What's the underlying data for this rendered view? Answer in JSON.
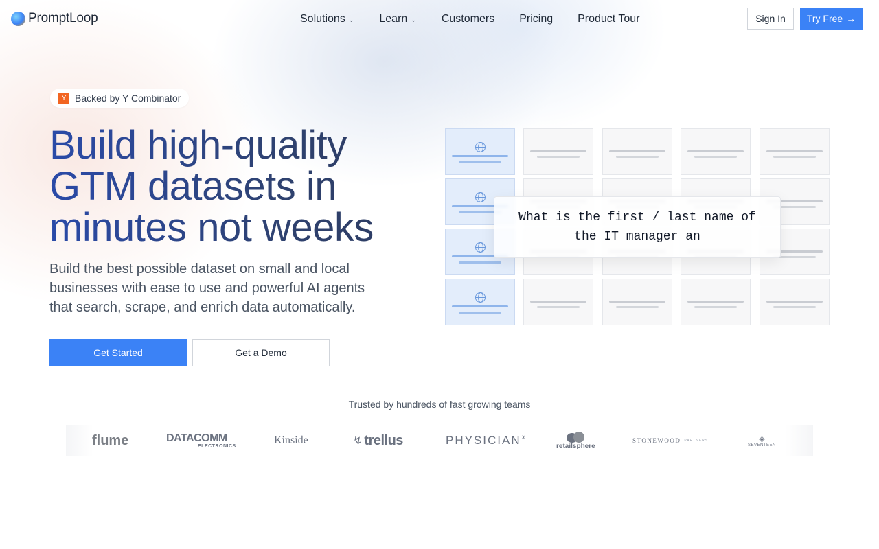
{
  "brand": {
    "name": "PromptLoop"
  },
  "nav": {
    "items": [
      {
        "label": "Solutions",
        "has_dropdown": true
      },
      {
        "label": "Learn",
        "has_dropdown": true
      },
      {
        "label": "Customers",
        "has_dropdown": false
      },
      {
        "label": "Pricing",
        "has_dropdown": false
      },
      {
        "label": "Product Tour",
        "has_dropdown": false
      }
    ],
    "sign_in": "Sign In",
    "try_free": "Try Free",
    "try_free_arrow": "→"
  },
  "hero": {
    "badge": {
      "logo_letter": "Y",
      "text": "Backed by Y Combinator"
    },
    "title": "Build high-quality GTM datasets in minutes not weeks",
    "subtitle": "Build the best possible dataset on small and local businesses with ease to use and powerful AI agents that search, scrape, and enrich data automatically.",
    "primary_cta": "Get Started",
    "secondary_cta": "Get a Demo"
  },
  "grid_demo": {
    "query": "What is the first / last name of the IT manager an",
    "rows": 4,
    "cols": 5,
    "first_col_icon": "globe-icon"
  },
  "trusted": {
    "heading": "Trusted by hundreds of fast growing teams",
    "logos": [
      "flume",
      "DATACOMM",
      "ELECTRONICS",
      "Kinside",
      "trellus",
      "PHYSICIAN",
      "x",
      "retailsphere",
      "STONEWOOD",
      "PARTNERS",
      "SEVENTEEN"
    ]
  },
  "colors": {
    "accent": "#3b82f6",
    "title_gradient_start": "#2a4aa8",
    "title_gradient_end": "#2c3a5e",
    "yc_orange": "#f26522"
  }
}
